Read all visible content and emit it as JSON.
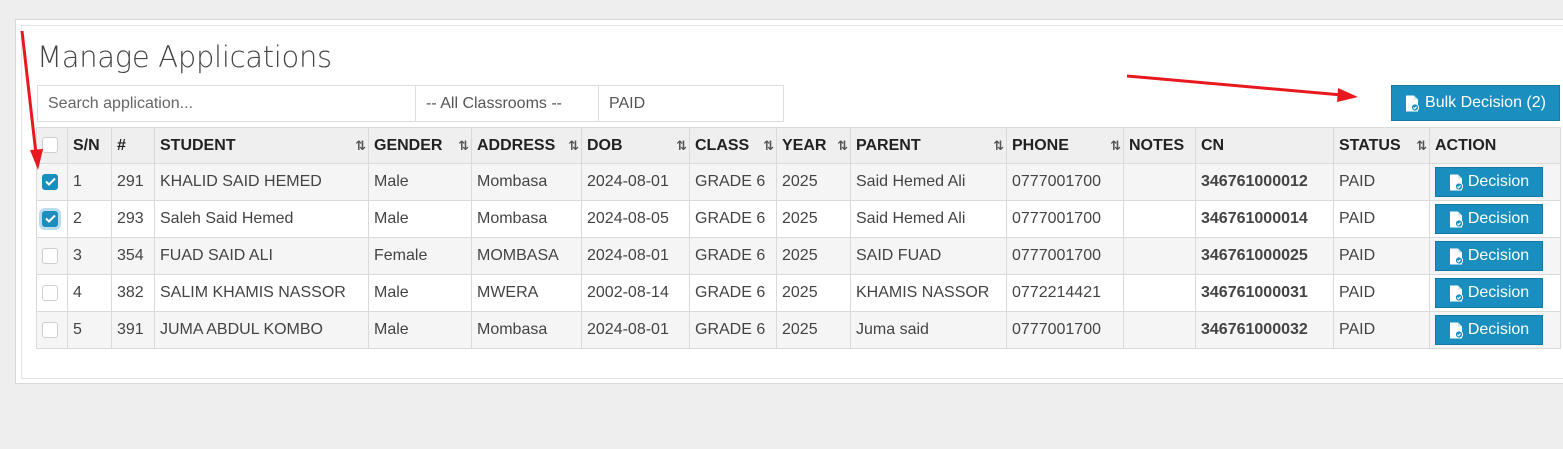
{
  "page": {
    "title": "Manage Applications"
  },
  "filters": {
    "search_placeholder": "Search application...",
    "classroom": "-- All Classrooms --",
    "status": "PAID"
  },
  "bulk_button": {
    "label": "Bulk Decision (2)",
    "icon": "document-check-icon"
  },
  "table": {
    "sort_icon_glyph": "⇅",
    "columns": [
      {
        "key": "select",
        "label": "",
        "sortable": false
      },
      {
        "key": "sn",
        "label": "S/N",
        "sortable": false
      },
      {
        "key": "id",
        "label": "#",
        "sortable": false
      },
      {
        "key": "student",
        "label": "STUDENT",
        "sortable": true
      },
      {
        "key": "gender",
        "label": "GENDER",
        "sortable": true
      },
      {
        "key": "address",
        "label": "ADDRESS",
        "sortable": true
      },
      {
        "key": "dob",
        "label": "DOB",
        "sortable": true
      },
      {
        "key": "class",
        "label": "CLASS",
        "sortable": true
      },
      {
        "key": "year",
        "label": "YEAR",
        "sortable": true
      },
      {
        "key": "parent",
        "label": "PARENT",
        "sortable": true
      },
      {
        "key": "phone",
        "label": "PHONE",
        "sortable": true
      },
      {
        "key": "notes",
        "label": "NOTES",
        "sortable": false
      },
      {
        "key": "cn",
        "label": "CN",
        "sortable": false
      },
      {
        "key": "status",
        "label": "STATUS",
        "sortable": true
      },
      {
        "key": "action",
        "label": "ACTION",
        "sortable": false
      }
    ],
    "decision_label": "Decision",
    "rows": [
      {
        "checked": true,
        "sn": "1",
        "id": "291",
        "student": "KHALID SAID HEMED",
        "gender": "Male",
        "address": "Mombasa",
        "dob": "2024-08-01",
        "class": "GRADE 6",
        "year": "2025",
        "parent": "Said Hemed Ali",
        "phone": "0777001700",
        "notes": "",
        "cn": "346761000012",
        "status": "PAID"
      },
      {
        "checked": true,
        "sn": "2",
        "id": "293",
        "student": "Saleh Said Hemed",
        "gender": "Male",
        "address": "Mombasa",
        "dob": "2024-08-05",
        "class": "GRADE 6",
        "year": "2025",
        "parent": "Said Hemed Ali",
        "phone": "0777001700",
        "notes": "",
        "cn": "346761000014",
        "status": "PAID"
      },
      {
        "checked": false,
        "sn": "3",
        "id": "354",
        "student": "FUAD SAID ALI",
        "gender": "Female",
        "address": "MOMBASA",
        "dob": "2024-08-01",
        "class": "GRADE 6",
        "year": "2025",
        "parent": "SAID FUAD",
        "phone": "0777001700",
        "notes": "",
        "cn": "346761000025",
        "status": "PAID"
      },
      {
        "checked": false,
        "sn": "4",
        "id": "382",
        "student": "SALIM KHAMIS NASSOR",
        "gender": "Male",
        "address": "MWERA",
        "dob": "2002-08-14",
        "class": "GRADE 6",
        "year": "2025",
        "parent": "KHAMIS NASSOR",
        "phone": "0772214421",
        "notes": "",
        "cn": "346761000031",
        "status": "PAID"
      },
      {
        "checked": false,
        "sn": "5",
        "id": "391",
        "student": "JUMA ABDUL KOMBO",
        "gender": "Male",
        "address": "Mombasa",
        "dob": "2024-08-01",
        "class": "GRADE 6",
        "year": "2025",
        "parent": "Juma said",
        "phone": "0777001700",
        "notes": "",
        "cn": "346761000032",
        "status": "PAID"
      }
    ]
  },
  "colors": {
    "accent": "#1a8fbf",
    "cn_green": "#4fa34f",
    "annotation_arrow": "#e8191e"
  }
}
